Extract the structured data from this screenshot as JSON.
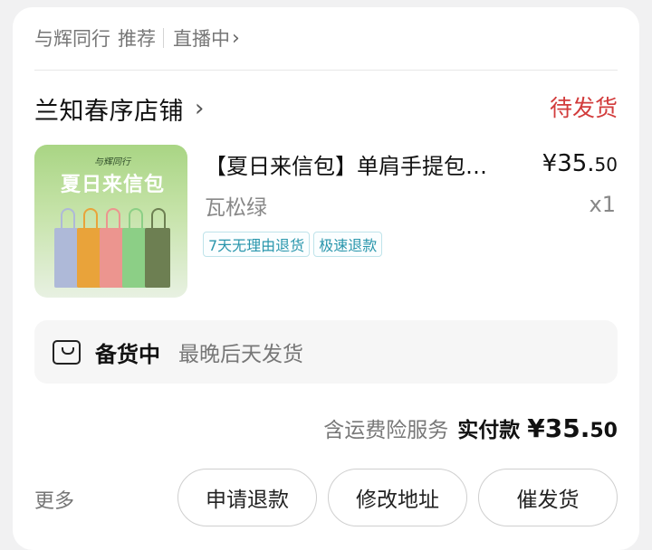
{
  "source": {
    "channel": "与辉同行",
    "recommend": "推荐",
    "live": "直播中"
  },
  "shop": {
    "name": "兰知春序店铺",
    "order_status": "待发货"
  },
  "product": {
    "thumb_brand": "与辉同行",
    "thumb_title": "夏日来信包",
    "title": "【夏日来信包】单肩手提包托特包",
    "variant": "瓦松绿",
    "price_main": "¥35.",
    "price_cents": "50",
    "quantity": "x1",
    "tags": [
      "7天无理由退货",
      "极速退款"
    ],
    "bag_colors": [
      "#aeb9d8",
      "#e9a33a",
      "#ec958f",
      "#8ccf86",
      "#6d7f52"
    ]
  },
  "stock": {
    "icon": "box-icon",
    "status": "备货中",
    "note": "最晚后天发货"
  },
  "totals": {
    "service": "含运费险服务",
    "label": "实付款",
    "amount_main": "¥35.",
    "amount_cents": "50"
  },
  "actions": {
    "more": "更多",
    "refund": "申请退款",
    "edit_address": "修改地址",
    "urge": "催发货"
  }
}
